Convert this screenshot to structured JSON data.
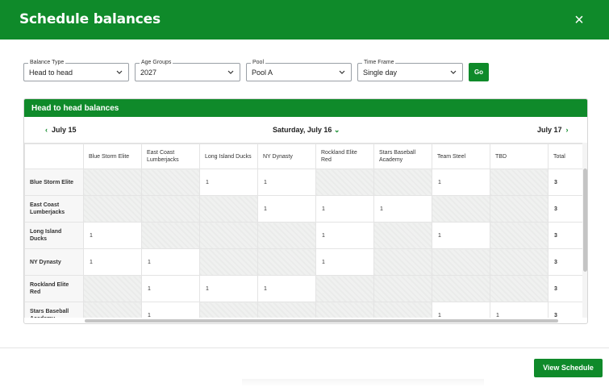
{
  "modal": {
    "title": "Schedule balances",
    "close_icon": "×"
  },
  "filters": [
    {
      "label": "Balance Type",
      "value": "Head to head"
    },
    {
      "label": "Age Groups",
      "value": "2027"
    },
    {
      "label": "Pool",
      "value": "Pool A"
    },
    {
      "label": "Time Frame",
      "value": "Single day"
    }
  ],
  "go_label": "Go",
  "panel": {
    "title": "Head to head balances"
  },
  "day_nav": {
    "prev": "July 15",
    "current": "Saturday, July 16",
    "next": "July 17"
  },
  "table": {
    "columns": [
      "",
      "Blue Storm Elite",
      "East Coast Lumberjacks",
      "Long Island Ducks",
      "NY Dynasty",
      "Rockland Elite Red",
      "Stars Baseball Academy",
      "Team Steel",
      "TBD",
      "Total"
    ],
    "rows": [
      {
        "team": "Blue Storm Elite",
        "cells": [
          null,
          null,
          "1",
          "1",
          null,
          null,
          "1",
          null
        ],
        "total": "3"
      },
      {
        "team": "East Coast Lumberjacks",
        "cells": [
          null,
          null,
          null,
          "1",
          "1",
          "1",
          null,
          null
        ],
        "total": "3"
      },
      {
        "team": "Long Island Ducks",
        "cells": [
          "1",
          null,
          null,
          null,
          "1",
          null,
          "1",
          null
        ],
        "total": "3"
      },
      {
        "team": "NY Dynasty",
        "cells": [
          "1",
          "1",
          null,
          null,
          "1",
          null,
          null,
          null
        ],
        "total": "3"
      },
      {
        "team": "Rockland Elite Red",
        "cells": [
          null,
          "1",
          "1",
          "1",
          null,
          null,
          null,
          null
        ],
        "total": "3"
      },
      {
        "team": "Stars Baseball Academy",
        "cells": [
          null,
          "1",
          null,
          null,
          null,
          null,
          "1",
          "1"
        ],
        "total": "3"
      }
    ]
  },
  "footer": {
    "view_schedule": "View Schedule"
  },
  "colors": {
    "brand": "#0f8a2a"
  }
}
